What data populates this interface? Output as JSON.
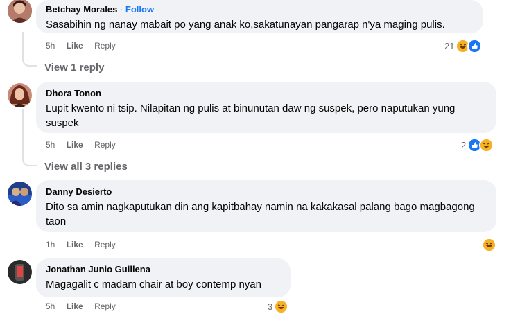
{
  "comments": [
    {
      "name": "Betchay Morales",
      "follow": "Follow",
      "separator": "·",
      "text": "Sasabihin ng nanay mabait po yang anak ko,sakatunayan pangarap n'ya maging pulis.",
      "time": "5h",
      "like": "Like",
      "reply": "Reply",
      "react_count": "21",
      "reactions": [
        "haha-icon",
        "like-icon"
      ],
      "view_replies": "View 1 reply"
    },
    {
      "name": "Dhora Tonon",
      "text": "Lupit kwento ni tsip. Nilapitan ng pulis at binunutan daw ng suspek, pero naputukan yung suspek",
      "time": "5h",
      "like": "Like",
      "reply": "Reply",
      "react_count": "2",
      "reactions": [
        "like-icon",
        "haha-icon"
      ],
      "view_replies": "View all 3 replies"
    },
    {
      "name": "Danny Desierto",
      "text": "Dito sa amin nagkaputukan din ang kapitbahay namin na kakakasal palang bago magbagong taon",
      "time": "1h",
      "like": "Like",
      "reply": "Reply",
      "react_count": "",
      "reactions": [
        "haha-icon"
      ]
    },
    {
      "name": "Jonathan Junio Guillena",
      "text": "Magagalit c madam chair at boy contemp nyan",
      "time": "5h",
      "like": "Like",
      "reply": "Reply",
      "react_count": "3",
      "reactions": [
        "haha-icon"
      ]
    }
  ],
  "colors": {
    "bubble": "#f0f2f5",
    "link": "#1877f2",
    "muted": "#65676b",
    "haha": "#f7b125",
    "like": "#1877f2"
  }
}
